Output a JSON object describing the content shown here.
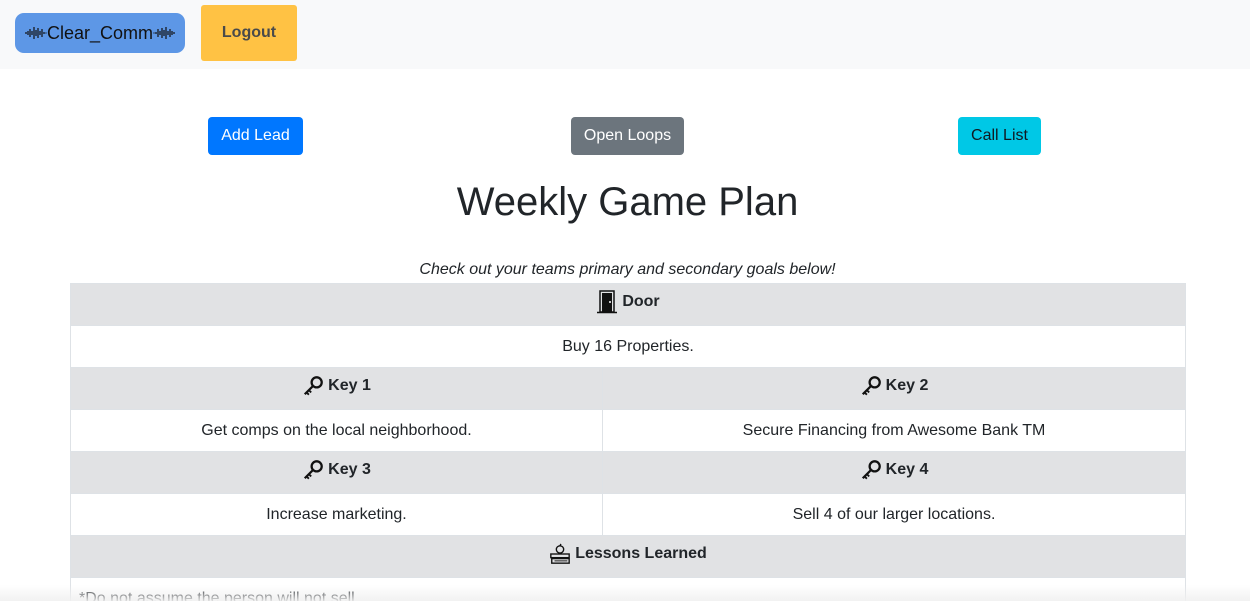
{
  "navbar": {
    "brand_label": "Clear_Comm",
    "brand_icon": "sound-wave-icon",
    "logout_label": "Logout"
  },
  "actions": {
    "add_lead": "Add Lead",
    "open_loops": "Open Loops",
    "call_list": "Call List"
  },
  "page": {
    "title": "Weekly Game Plan",
    "subtitle": "Check out your teams primary and secondary goals below!"
  },
  "plan": {
    "door": {
      "label": "Door",
      "icon": "door-icon",
      "goal": "Buy 16 Properties."
    },
    "keys": [
      {
        "label": "Key 1",
        "icon": "key-icon",
        "goal": "Get comps on the local neighborhood."
      },
      {
        "label": "Key 2",
        "icon": "key-icon",
        "goal": "Secure Financing from Awesome Bank TM"
      },
      {
        "label": "Key 3",
        "icon": "key-icon",
        "goal": "Increase marketing."
      },
      {
        "label": "Key 4",
        "icon": "key-icon",
        "goal": "Sell 4 of our larger locations."
      }
    ],
    "lessons": {
      "label": "Lessons Learned",
      "icon": "books-apple-icon",
      "text": "*Do not assume the person will not sell."
    }
  }
}
